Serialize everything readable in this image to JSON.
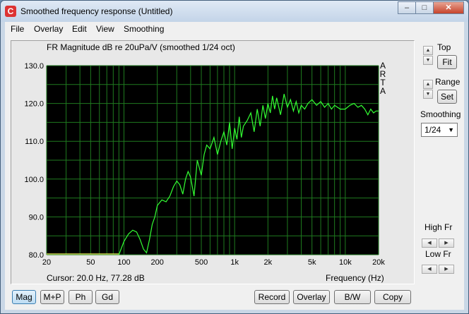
{
  "window": {
    "title": "Smoothed frequency response (Untitled)",
    "app_icon_letter": "C",
    "controls": {
      "minimize": "–",
      "maximize": "□",
      "close": "✕"
    }
  },
  "menu": [
    "File",
    "Overlay",
    "Edit",
    "View",
    "Smoothing"
  ],
  "chart_data": {
    "type": "line",
    "title": "FR Magnitude dB re 20uPa/V (smoothed 1/24 oct)",
    "watermark": [
      "A",
      "R",
      "T",
      "A"
    ],
    "xlabel": "Frequency (Hz)",
    "x_scale": "log",
    "xlim": [
      20,
      20000
    ],
    "ylim": [
      80,
      130
    ],
    "x_ticks": [
      {
        "v": 20,
        "label": "20"
      },
      {
        "v": 50,
        "label": "50"
      },
      {
        "v": 100,
        "label": "100"
      },
      {
        "v": 200,
        "label": "200"
      },
      {
        "v": 500,
        "label": "500"
      },
      {
        "v": 1000,
        "label": "1k"
      },
      {
        "v": 2000,
        "label": "2k"
      },
      {
        "v": 5000,
        "label": "5k"
      },
      {
        "v": 10000,
        "label": "10k"
      },
      {
        "v": 20000,
        "label": "20k"
      }
    ],
    "y_ticks": [
      {
        "v": 130,
        "label": "130.0"
      },
      {
        "v": 120,
        "label": "120.0"
      },
      {
        "v": 110,
        "label": "110.0"
      },
      {
        "v": 100,
        "label": "100.0"
      },
      {
        "v": 90,
        "label": "90.0"
      },
      {
        "v": 80,
        "label": "80.0"
      }
    ],
    "grid": true,
    "series": [
      {
        "color": "#33ff33",
        "x": [
          90,
          100,
          110,
          120,
          130,
          140,
          150,
          160,
          170,
          180,
          190,
          200,
          220,
          240,
          260,
          280,
          300,
          320,
          340,
          360,
          380,
          400,
          430,
          460,
          500,
          530,
          560,
          600,
          650,
          700,
          750,
          800,
          850,
          900,
          950,
          1000,
          1050,
          1100,
          1150,
          1200,
          1300,
          1400,
          1500,
          1600,
          1700,
          1800,
          1900,
          2000,
          2100,
          2200,
          2300,
          2400,
          2600,
          2800,
          3000,
          3200,
          3400,
          3600,
          3800,
          4000,
          4300,
          4600,
          5000,
          5500,
          6000,
          6500,
          7000,
          7500,
          8000,
          8500,
          9000,
          10000,
          11000,
          12000,
          13000,
          14000,
          15000,
          16000,
          17000,
          18000,
          19000,
          20000
        ],
        "y": [
          80.0,
          83.5,
          85.5,
          86.5,
          86.0,
          84.0,
          81.5,
          80.5,
          84.0,
          88.0,
          90.0,
          93.0,
          94.5,
          94.0,
          95.5,
          98.0,
          99.5,
          98.5,
          96.0,
          100.0,
          102.0,
          100.5,
          95.5,
          105.0,
          101.0,
          106.5,
          109.0,
          108.0,
          111.0,
          106.5,
          110.0,
          112.5,
          109.0,
          115.0,
          108.0,
          113.5,
          110.5,
          116.5,
          111.0,
          114.0,
          115.5,
          117.5,
          112.5,
          118.5,
          114.0,
          119.5,
          116.0,
          120.0,
          117.5,
          122.0,
          118.5,
          121.5,
          117.0,
          122.5,
          119.0,
          121.0,
          118.0,
          120.5,
          117.5,
          119.5,
          118.5,
          120.0,
          121.0,
          119.5,
          120.5,
          119.0,
          120.0,
          118.5,
          119.5,
          119.0,
          118.5,
          118.5,
          119.5,
          120.0,
          119.0,
          119.5,
          118.5,
          117.0,
          118.5,
          117.5,
          118.0,
          118.0
        ]
      },
      {
        "color": "#e8e85a",
        "x": [
          20,
          90
        ],
        "y": [
          80.2,
          80.2
        ]
      }
    ]
  },
  "cursor_readout": "Cursor: 20.0 Hz, 77.28 dB",
  "right_panel": {
    "top_label": "Top",
    "fit_label": "Fit",
    "range_label": "Range",
    "set_label": "Set",
    "smoothing_label": "Smoothing",
    "smoothing_value": "1/24",
    "high_fr_label": "High Fr",
    "low_fr_label": "Low Fr"
  },
  "bottom_buttons": {
    "mag": "Mag",
    "mp": "M+P",
    "ph": "Ph",
    "gd": "Gd",
    "record": "Record",
    "overlay": "Overlay",
    "bw": "B/W",
    "copy": "Copy"
  }
}
